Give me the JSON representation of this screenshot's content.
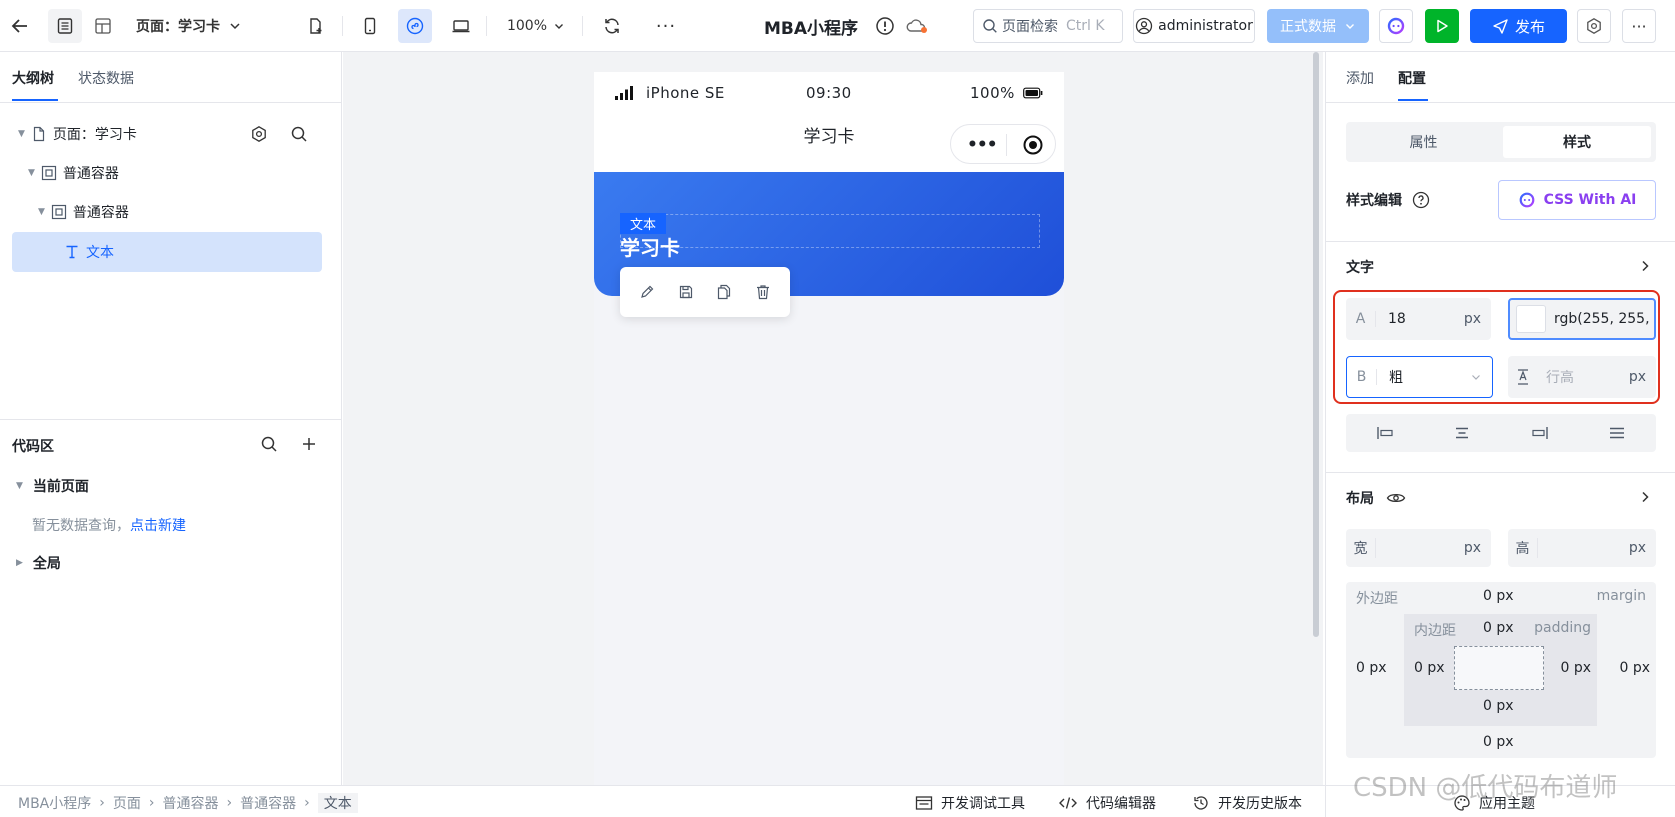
{
  "topbar": {
    "page_label": "页面：学习卡",
    "zoom": "100%",
    "app_title": "MBA小程序",
    "search_placeholder": "页面检索",
    "search_shortcut": "Ctrl K",
    "user": "administrator",
    "data_env": "正式数据",
    "publish": "发布"
  },
  "left": {
    "tabs": [
      "大纲树",
      "状态数据"
    ],
    "tree": {
      "page": "页面：学习卡",
      "container1": "普通容器",
      "container2": "普通容器",
      "text": "文本"
    },
    "code": {
      "title": "代码区",
      "current_page": "当前页面",
      "empty_text": "暂无数据查询，",
      "create_link": "点击新建",
      "global": "全局"
    }
  },
  "phone": {
    "carrier": "iPhone SE",
    "time": "09:30",
    "battery": "100%",
    "nav_title": "学习卡",
    "tag": "文本",
    "heading": "学习卡"
  },
  "right": {
    "tabs": [
      "添加",
      "配置"
    ],
    "seg": [
      "属性",
      "样式"
    ],
    "style_edit": "样式编辑",
    "ai_button": "CSS With AI",
    "text_section": "文字",
    "font_size_prefix": "A",
    "font_size": "18",
    "px": "px",
    "color_value": "rgb(255, 255,",
    "weight_prefix": "B",
    "weight": "粗",
    "line_height_placeholder": "行高",
    "layout_section": "布局",
    "width_label": "宽",
    "height_label": "高",
    "margin_label": "外边距",
    "margin_en": "margin",
    "padding_label": "内边距",
    "padding_en": "padding",
    "zero": "0 px"
  },
  "footer": {
    "crumbs": [
      "MBA小程序",
      "页面",
      "普通容器",
      "普通容器",
      "文本"
    ],
    "debug": "开发调试工具",
    "code_editor": "代码编辑器",
    "history": "开发历史版本",
    "theme": "应用主题",
    "watermark": "CSDN @低代码布道师"
  },
  "colors": {
    "primary": "#1664ff",
    "green": "#00b42a",
    "highlight_red": "#e0301e",
    "banner_start": "#3a7bf0",
    "banner_end": "#1f4fd8"
  }
}
